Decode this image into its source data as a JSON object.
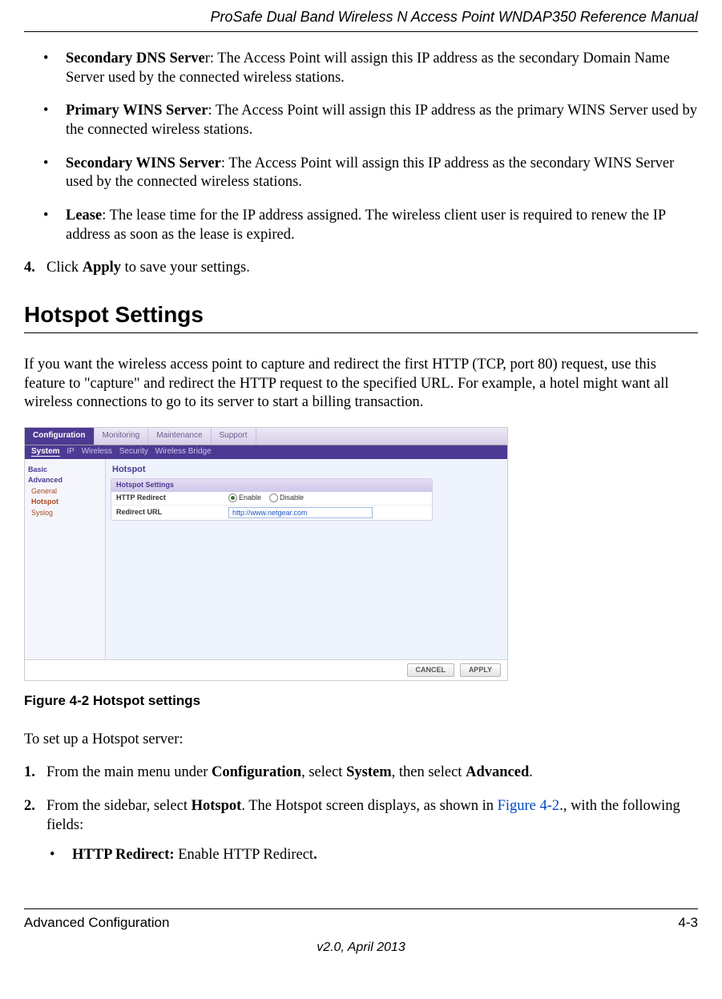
{
  "header": {
    "title": "ProSafe Dual Band Wireless N Access Point WNDAP350 Reference Manual"
  },
  "bullets1": [
    {
      "label_bold": "Secondary DNS Serve",
      "label_tail": "r",
      "desc": ": The Access Point will assign this IP address as the secondary Domain Name Server used by the connected wireless stations."
    },
    {
      "label_bold": "Primary WINS Server",
      "label_tail": "",
      "desc": ": The Access Point will assign this IP address as the primary WINS Server used by the connected wireless stations."
    },
    {
      "label_bold": "Secondary WINS Server",
      "label_tail": "",
      "desc": ": The Access Point will assign this IP address as the secondary WINS Server used by the connected wireless stations."
    },
    {
      "label_bold": "Lease",
      "label_tail": "",
      "desc": ": The lease time for the IP address assigned. The wireless client user is required to renew the IP address as soon as the lease is expired."
    }
  ],
  "step4": {
    "num": "4.",
    "pre": "Click ",
    "bold": "Apply",
    "post": " to save your settings."
  },
  "section": "Hotspot Settings",
  "intro": "If you want the wireless access point to capture and redirect the first HTTP (TCP, port 80) request, use this feature to \"capture\" and redirect the HTTP request to the specified URL. For example, a hotel might want all wireless connections to go to its server to start a billing transaction.",
  "mock": {
    "tabs": [
      "Configuration",
      "Monitoring",
      "Maintenance",
      "Support"
    ],
    "subnav": [
      "System",
      "IP",
      "Wireless",
      "Security",
      "Wireless Bridge"
    ],
    "side": {
      "top": "Basic",
      "group": "Advanced",
      "items": [
        "General",
        "Hotspot",
        "Syslog"
      ]
    },
    "title": "Hotspot",
    "panel_title": "Hotspot Settings",
    "row1": {
      "label": "HTTP Redirect",
      "opt1": "Enable",
      "opt2": "Disable"
    },
    "row2": {
      "label": "Redirect URL",
      "value": "http://www.netgear.com"
    },
    "btn_cancel": "CANCEL",
    "btn_apply": "APPLY"
  },
  "fig_caption": "Figure 4-2  Hotspot settings",
  "setup_intro": "To set up a Hotspot server:",
  "step1": {
    "num": "1.",
    "pre": "From the main menu under ",
    "b1": "Configuration",
    "mid1": ", select ",
    "b2": "System",
    "mid2": ", then select ",
    "b3": "Advanced",
    "post": "."
  },
  "step2": {
    "num": "2.",
    "pre": "From the sidebar, select ",
    "b1": "Hotspot",
    "mid": ". The Hotspot screen displays, as shown in ",
    "linktext": "Figure 4-2",
    "post": "., with the following fields:",
    "sub": {
      "bold": "HTTP Redirect: ",
      "text": "Enable HTTP Redirect",
      "tailbold": "."
    }
  },
  "footer": {
    "left": "Advanced Configuration",
    "right": "4-3",
    "version": "v2.0, April 2013"
  }
}
